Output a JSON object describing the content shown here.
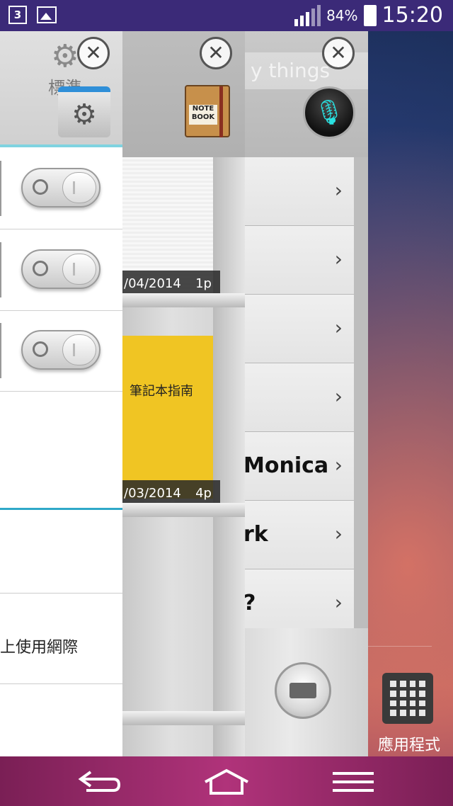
{
  "status_bar": {
    "sim_label": "3",
    "battery_percent": "84%",
    "time": "15:20",
    "icons": [
      "sim-icon",
      "gallery-icon",
      "signal-icon",
      "battery-icon"
    ]
  },
  "settings_panel": {
    "tab_label": "標準",
    "toggles": [
      {
        "state": "off"
      },
      {
        "state": "off"
      },
      {
        "state": "off"
      }
    ],
    "row_text": "上使用網際"
  },
  "notebook_panel": {
    "notes": [
      {
        "title": "",
        "date": "/04/2014",
        "pages": "1p"
      },
      {
        "title": "筆記本指南",
        "date": "/03/2014",
        "pages": "4p"
      }
    ],
    "icon_label": "NOTE BOOK"
  },
  "voice_panel": {
    "search_placeholder": "y things",
    "items": [
      {
        "text": "",
        "chevron": "›"
      },
      {
        "text": "",
        "chevron": "›"
      },
      {
        "text": "",
        "chevron": "›"
      },
      {
        "text": "",
        "chevron": "›"
      },
      {
        "text": "Monica",
        "chevron": "›"
      },
      {
        "text": "rk",
        "chevron": "›"
      },
      {
        "text": "?",
        "chevron": "›"
      }
    ]
  },
  "close_symbol": "✕",
  "home_screen": {
    "apps_label": "應用程式"
  },
  "nav_bar": {
    "back": "back-icon",
    "home": "home-icon",
    "menu": "menu-icon"
  },
  "colors": {
    "status_bar": "#3b2a78",
    "nav_bar": "#b0337a",
    "accent_teal": "#2fa8c8",
    "note_yellow": "#f0c523",
    "mic_cyan": "#29e0e0"
  }
}
